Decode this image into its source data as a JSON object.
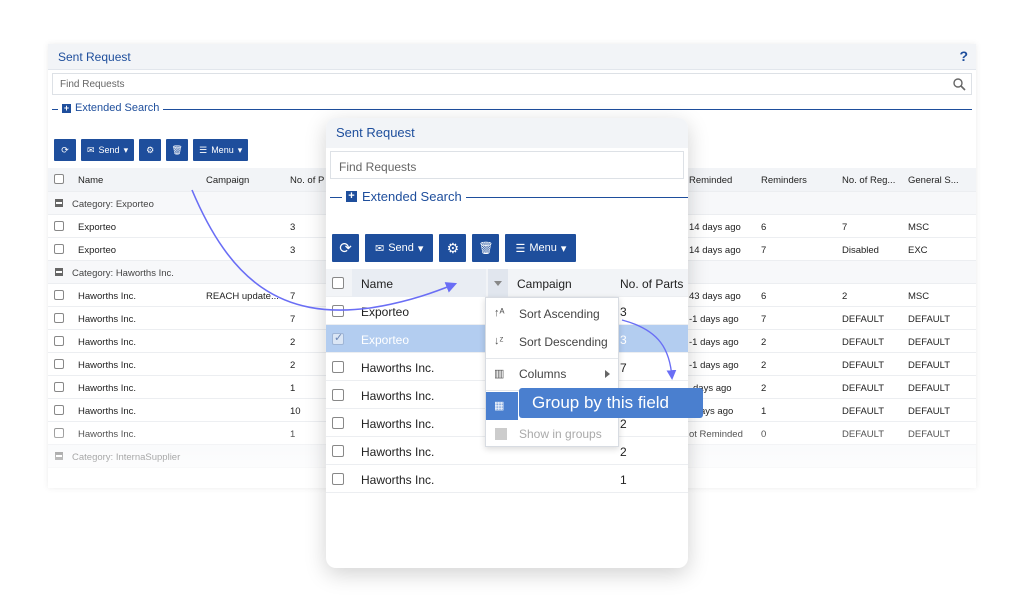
{
  "background_panel": {
    "title": "Sent Request",
    "help": "?",
    "search_placeholder": "Find Requests",
    "extended_search": "Extended Search",
    "toolbar": {
      "send": "Send",
      "menu": "Menu"
    },
    "headers": {
      "name": "Name",
      "campaign": "Campaign",
      "no_parts": "No. of P",
      "reminded": "Reminded",
      "reminders": "Reminders",
      "no_reg": "No. of Reg...",
      "general": "General S..."
    },
    "groups": [
      {
        "label": "Category: Exporteo"
      },
      {
        "label": "Category: Haworths Inc."
      },
      {
        "label": "Category: InternaSupplier"
      }
    ],
    "rows": [
      {
        "name": "Exporteo",
        "campaign": "",
        "parts": "3",
        "reminded": "14 days ago",
        "reminders": "6",
        "reg": "7",
        "general": "MSC"
      },
      {
        "name": "Exporteo",
        "campaign": "",
        "parts": "3",
        "reminded": "14 days ago",
        "reminders": "7",
        "reg": "Disabled",
        "general": "EXC"
      },
      {
        "name": "Haworths Inc.",
        "campaign": "REACH update...",
        "parts": "7",
        "reminded": "43 days ago",
        "reminders": "6",
        "reg": "2",
        "general": "MSC"
      },
      {
        "name": "Haworths Inc.",
        "campaign": "",
        "parts": "7",
        "reminded": "-1 days ago",
        "reminders": "7",
        "reg": "DEFAULT",
        "general": "DEFAULT"
      },
      {
        "name": "Haworths Inc.",
        "campaign": "",
        "parts": "2",
        "reminded": "-1 days ago",
        "reminders": "2",
        "reg": "DEFAULT",
        "general": "DEFAULT"
      },
      {
        "name": "Haworths Inc.",
        "campaign": "",
        "parts": "2",
        "reminded": "-1 days ago",
        "reminders": "2",
        "reg": "DEFAULT",
        "general": "DEFAULT"
      },
      {
        "name": "Haworths Inc.",
        "campaign": "",
        "parts": "1",
        "reminded": "days ago",
        "reminders": "2",
        "reg": "DEFAULT",
        "general": "DEFAULT"
      },
      {
        "name": "Haworths Inc.",
        "campaign": "",
        "parts": "10",
        "reminded": "ays ago",
        "reminders": "1",
        "reg": "DEFAULT",
        "general": "DEFAULT"
      },
      {
        "name": "Haworths Inc.",
        "campaign": "",
        "parts": "1",
        "reminded": "ot Reminded",
        "reminders": "0",
        "reg": "DEFAULT",
        "general": "DEFAULT"
      }
    ]
  },
  "card": {
    "title": "Sent Request",
    "search_placeholder": "Find Requests",
    "extended_search": "Extended Search",
    "toolbar": {
      "send": "Send",
      "menu": "Menu"
    },
    "headers": {
      "name": "Name",
      "campaign": "Campaign",
      "no_parts": "No. of Parts"
    },
    "rows": [
      {
        "name": "Exporteo",
        "parts": "3",
        "selected": false
      },
      {
        "name": "Exporteo",
        "parts": "3",
        "selected": true
      },
      {
        "name": "Haworths Inc.",
        "parts": "7",
        "selected": false
      },
      {
        "name": "Haworths Inc.",
        "parts": "",
        "selected": false
      },
      {
        "name": "Haworths Inc.",
        "parts": "2",
        "selected": false
      },
      {
        "name": "Haworths Inc.",
        "parts": "2",
        "selected": false
      },
      {
        "name": "Haworths Inc.",
        "parts": "1",
        "selected": false
      }
    ]
  },
  "context_menu": {
    "sort_asc": "Sort Ascending",
    "sort_desc": "Sort Descending",
    "columns": "Columns",
    "group": "Group by this field",
    "show_groups": "Show in groups"
  },
  "colors": {
    "brand": "#1e4e9c",
    "highlight": "#4a7fcf",
    "selected_row": "#b3cdf0"
  }
}
